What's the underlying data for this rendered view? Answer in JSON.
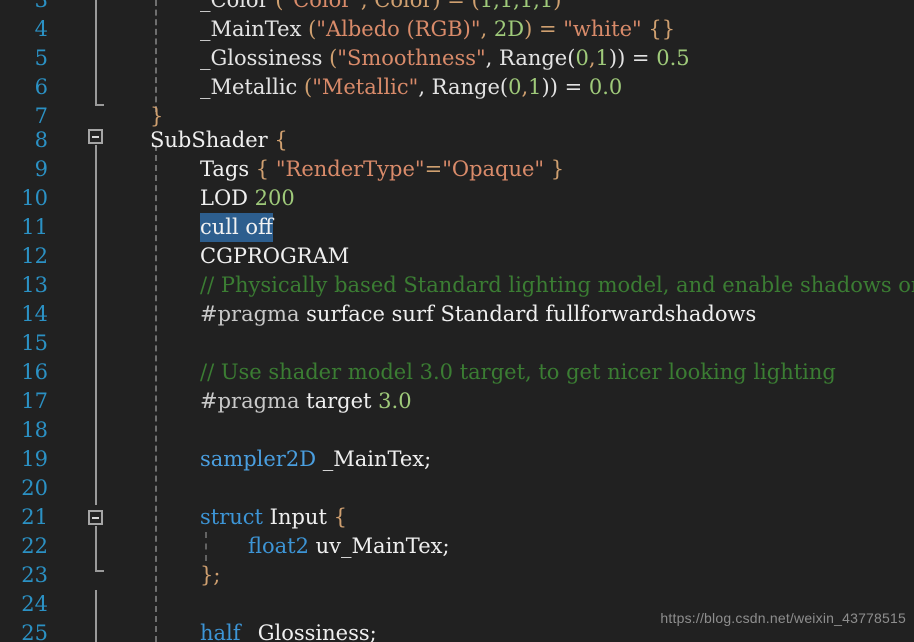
{
  "editor": {
    "language": "ShaderLab",
    "theme": "dark",
    "background_color": "#212121",
    "line_number_color": "#2b91c4",
    "selection_color": "#2d5e8e",
    "first_visible_line": 3,
    "last_visible_line": 25,
    "selected_text": "cull off",
    "selected_line": 11
  },
  "lines": [
    {
      "num": "3",
      "text": "        _Color (\"Color\", Color) = (1,1,1,1)"
    },
    {
      "num": "4",
      "text": "        _MainTex (\"Albedo (RGB)\", 2D) = \"white\" {}"
    },
    {
      "num": "5",
      "text": "        _Glossiness (\"Smoothness\", Range(0,1)) = 0.5"
    },
    {
      "num": "6",
      "text": "        _Metallic (\"Metallic\", Range(0,1)) = 0.0"
    },
    {
      "num": "7",
      "text": "    }"
    },
    {
      "num": "8",
      "text": "    SubShader {"
    },
    {
      "num": "9",
      "text": "        Tags { \"RenderType\"=\"Opaque\" }"
    },
    {
      "num": "10",
      "text": "        LOD 200"
    },
    {
      "num": "11",
      "text": "        cull off"
    },
    {
      "num": "12",
      "text": "        CGPROGRAM"
    },
    {
      "num": "13",
      "text": "        // Physically based Standard lighting model, and enable shadows on all light types"
    },
    {
      "num": "14",
      "text": "        #pragma surface surf Standard fullforwardshadows"
    },
    {
      "num": "15",
      "text": ""
    },
    {
      "num": "16",
      "text": "        // Use shader model 3.0 target, to get nicer looking lighting"
    },
    {
      "num": "17",
      "text": "        #pragma target 3.0"
    },
    {
      "num": "18",
      "text": ""
    },
    {
      "num": "19",
      "text": "        sampler2D _MainTex;"
    },
    {
      "num": "20",
      "text": ""
    },
    {
      "num": "21",
      "text": "        struct Input {"
    },
    {
      "num": "22",
      "text": "            float2 uv_MainTex;"
    },
    {
      "num": "23",
      "text": "        };"
    },
    {
      "num": "24",
      "text": ""
    },
    {
      "num": "25",
      "text": "        half _Glossiness;"
    }
  ],
  "line_numbers": {
    "n3": "3",
    "n4": "4",
    "n5": "5",
    "n6": "6",
    "n7": "7",
    "n8": "8",
    "n9": "9",
    "n10": "10",
    "n11": "11",
    "n12": "12",
    "n13": "13",
    "n14": "14",
    "n15": "15",
    "n16": "16",
    "n17": "17",
    "n18": "18",
    "n19": "19",
    "n20": "20",
    "n21": "21",
    "n22": "22",
    "n23": "23",
    "n24": "24",
    "n25": "25"
  },
  "tokens": {
    "l3_color": "_Color",
    "l3_p1": " (",
    "l3_str": "\"Color\"",
    "l3_p2": ", Color) = (",
    "l3_nums": "1,1,1,1",
    "l3_p3": ")",
    "l4_name": "_MainTex",
    "l4_p1": " (",
    "l4_str": "\"Albedo (RGB)\"",
    "l4_p2": ", ",
    "l4_2d": "2D",
    "l4_p3": ") = ",
    "l4_white": "\"white\"",
    "l4_p4": " {}",
    "l5_name": "_Glossiness",
    "l5_p1": " (",
    "l5_str": "\"Smoothness\"",
    "l5_p2": ", Range(",
    "l5_n1": "0",
    "l5_c1": ",",
    "l5_n2": "1",
    "l5_p3": ")) = ",
    "l5_val": "0.5",
    "l6_name": "_Metallic",
    "l6_p1": " (",
    "l6_str": "\"Metallic\"",
    "l6_p2": ", Range(",
    "l6_n1": "0",
    "l6_c1": ",",
    "l6_n2": "1",
    "l6_p3": ")) = ",
    "l6_val": "0.0",
    "l7_brace": "}",
    "l8_key": "SubShader",
    "l8_brace": " {",
    "l9_tags": "Tags",
    "l9_b1": " { ",
    "l9_s1": "\"RenderType\"",
    "l9_eq": "=",
    "l9_s2": "\"Opaque\"",
    "l9_b2": " }",
    "l10_lod": "LOD",
    "l10_val": " 200",
    "l11_sel": "cull off",
    "l12_cg": "CGPROGRAM",
    "l13_com": "// Physically based Standard lighting model, and enable shadows on all light types",
    "l14_pragma": "#pragma",
    "l14_rest": " surface surf Standard fullforwardshadows",
    "l16_com": "// Use shader model 3.0 target, to get nicer looking lighting",
    "l17_pragma": "#pragma",
    "l17_target": " target ",
    "l17_num": "3.0",
    "l19_type": "sampler2D",
    "l19_name": " _MainTex;",
    "l21_key": "struct",
    "l21_name": " Input ",
    "l21_brace": "{",
    "l22_type": "float2",
    "l22_name": " uv_MainTex;",
    "l23_close": "};",
    "l25_type": "half",
    "l25_name": " _Glossiness;"
  },
  "watermark": {
    "url": "https://blog.csdn.net/weixin_43778515"
  }
}
